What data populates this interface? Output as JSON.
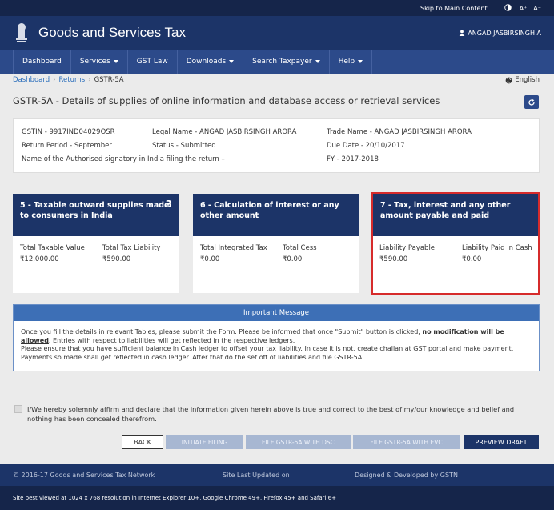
{
  "topbar": {
    "skip_link": "Skip to Main Content",
    "font_increase": "A⁺",
    "font_decrease": "A⁻"
  },
  "header": {
    "title": "Goods and Services Tax",
    "user": "ANGAD JASBIRSINGH A"
  },
  "nav": {
    "items": [
      "Dashboard",
      "Services",
      "GST Law",
      "Downloads",
      "Search Taxpayer",
      "Help"
    ]
  },
  "breadcrumb": {
    "items": [
      "Dashboard",
      "Returns",
      "GSTR-5A"
    ]
  },
  "language": "English",
  "page_title": "GSTR-5A - Details of supplies of online information and database access or retrieval services",
  "info": {
    "gstin": "GSTIN - 9917IND04029OSR",
    "legal_name": "Legal Name - ANGAD JASBIRSINGH ARORA",
    "trade_name": "Trade Name - ANGAD JASBIRSINGH ARORA",
    "return_period": "Return Period - September",
    "status": "Status - Submitted",
    "due_date": "Due Date - 20/10/2017",
    "signatory": "Name of the Authorised signatory in India filing the return –",
    "fy": "FY - 2017-2018"
  },
  "tiles": [
    {
      "title": "5 - Taxable outward supplies made to consumers in India",
      "badge": "3",
      "k1": "Total Taxable Value",
      "v1": "₹12,000.00",
      "k2": "Total Tax Liability",
      "v2": "₹590.00"
    },
    {
      "title": "6 - Calculation of interest or any other amount",
      "k1": "Total Integrated Tax",
      "v1": "₹0.00",
      "k2": "Total Cess",
      "v2": "₹0.00"
    },
    {
      "title": "7 - Tax, interest and any other amount payable and paid",
      "k1": "Liability Payable",
      "v1": "₹590.00",
      "k2": "Liability Paid in Cash",
      "v2": "₹0.00"
    }
  ],
  "message": {
    "header": "Important Message",
    "line1_pre": "Once you fill the details in relevant Tables, please submit the Form. Please be informed that once \"Submit\" button is clicked,",
    "line1_bold": "no modification will be allowed",
    "line1_post": ". Entries with respect to liabilities will get reflected in the respective ledgers.",
    "line2": "Please ensure that you have sufficient balance in Cash ledger to offset your tax liability. In case it is not, create challan at GST portal and make payment. Payments so made shall get reflected in cash ledger. After that do the set off of liabilities and file GSTR-5A."
  },
  "declaration": "I/We hereby solemnly affirm and declare that the information given herein above is true and correct to the best of my/our knowledge and belief and nothing has been concealed therefrom.",
  "buttons": {
    "back": "BACK",
    "initiate": "INITIATE FILING",
    "dsc": "FILE GSTR-5A WITH DSC",
    "evc": "FILE GSTR-5A WITH EVC",
    "preview": "PREVIEW DRAFT"
  },
  "footer": {
    "copyright": "© 2016-17 Goods and Services Tax Network",
    "updated": "Site Last Updated on",
    "designed": "Designed & Developed by GSTN",
    "browser_note": "Site best viewed at 1024 x 768 resolution in Internet Explorer 10+, Google Chrome 49+, Firefox 45+ and Safari 6+"
  },
  "colors": {
    "navy": "#1c3468",
    "nav_blue": "#2c4a8a",
    "selected_border": "#d62b2b",
    "message_header": "#3d6fb6"
  }
}
